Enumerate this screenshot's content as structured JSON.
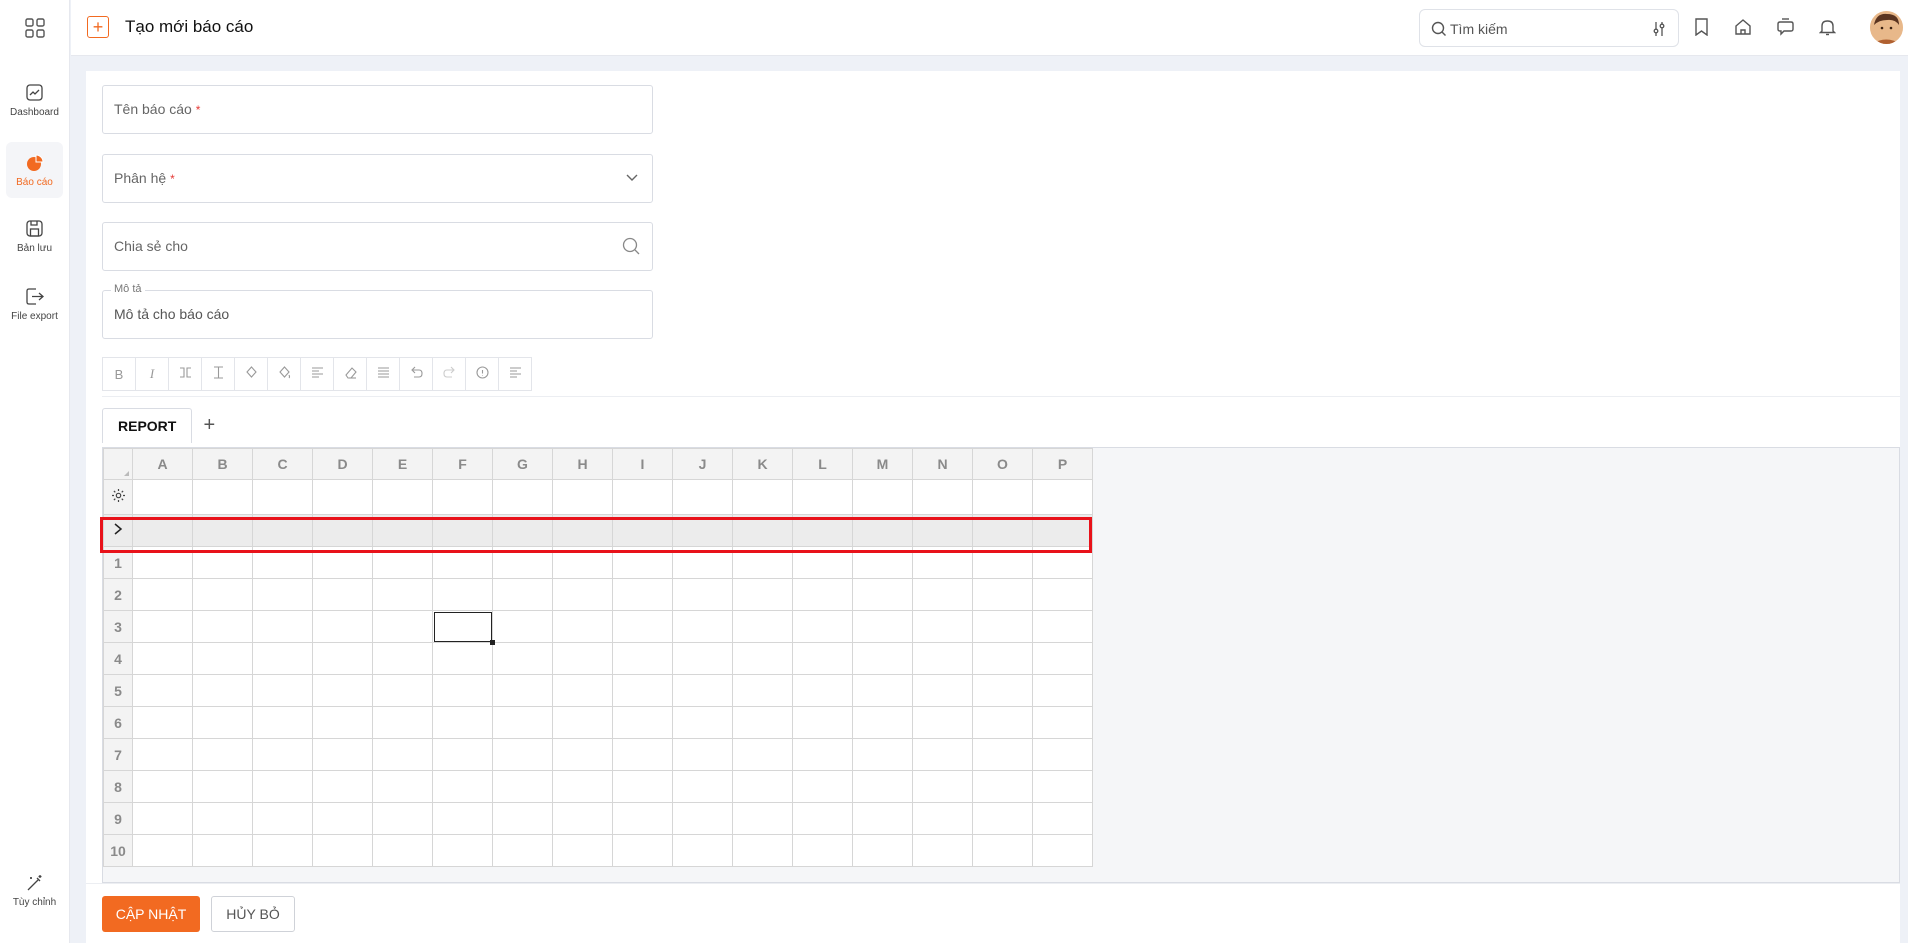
{
  "sidebar": {
    "items": [
      {
        "label": "Dashboard",
        "icon": "chart-line-icon"
      },
      {
        "label": "Báo cáo",
        "icon": "pie-chart-icon",
        "active": true
      },
      {
        "label": "Bản lưu",
        "icon": "save-icon"
      },
      {
        "label": "File export",
        "icon": "logout-icon"
      }
    ],
    "customize_label": "Tùy chỉnh"
  },
  "header": {
    "title": "Tạo mới báo cáo",
    "search_placeholder": "Tìm kiếm"
  },
  "form": {
    "name_placeholder": "Tên báo cáo",
    "module_placeholder": "Phân hệ",
    "required_mark": "*",
    "share_placeholder": "Chia sẻ cho",
    "description_legend": "Mô tả",
    "description_value": "Mô tả cho báo cáo"
  },
  "toolbar": {
    "bold": "B",
    "italic": "I"
  },
  "sheet": {
    "tabs": [
      "REPORT"
    ],
    "add_tab": "+",
    "columns": [
      "A",
      "B",
      "C",
      "D",
      "E",
      "F",
      "G",
      "H",
      "I",
      "J",
      "K",
      "L",
      "M",
      "N",
      "O",
      "P"
    ],
    "rows": [
      "1",
      "2",
      "3",
      "4",
      "5",
      "6",
      "7",
      "8",
      "9",
      "10"
    ],
    "selected_cell": "F3"
  },
  "footer": {
    "update_label": "CẬP NHẬT",
    "cancel_label": "HỦY BỎ"
  },
  "colors": {
    "accent": "#f26a21",
    "highlight": "#e8121a"
  }
}
